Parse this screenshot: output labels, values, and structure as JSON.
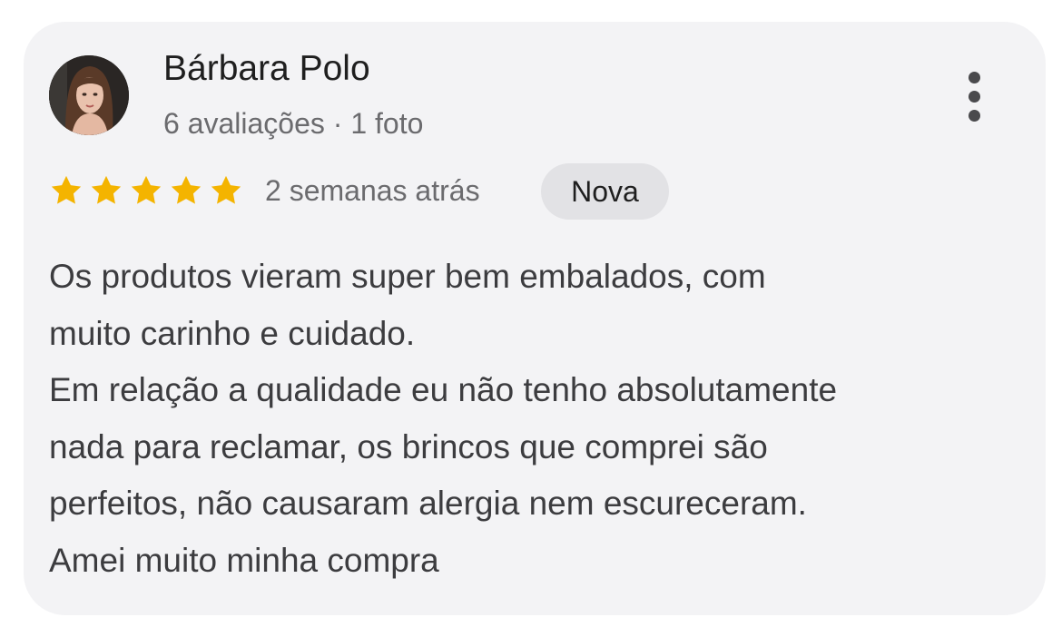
{
  "review": {
    "author_name": "Bárbara Polo",
    "author_meta": "6 avaliações · 1 foto",
    "rating": 5,
    "rating_max": 5,
    "time_ago": "2 semanas atrás",
    "badge": "Nova",
    "text_lines": [
      "Os produtos vieram super bem embalados, com",
      "muito carinho e cuidado.",
      "Em relação a qualidade eu não tenho absolutamente",
      "nada para reclamar, os brincos que comprei são",
      "perfeitos, não causaram alergia nem escureceram.",
      "Amei muito minha compra"
    ]
  },
  "icons": {
    "avatar": "user-avatar-photo",
    "more": "more-vertical-icon",
    "star": "star-filled-icon"
  },
  "colors": {
    "star": "#f4b400",
    "card_background": "#f3f3f5",
    "badge_background": "#e2e2e5"
  }
}
